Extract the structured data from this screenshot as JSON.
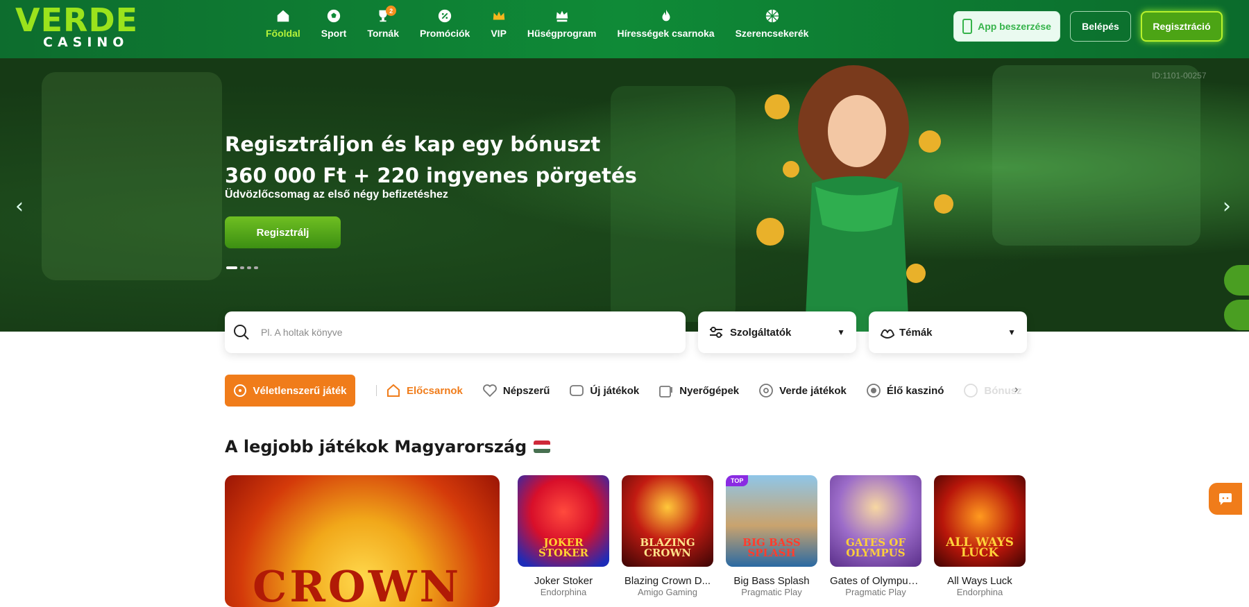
{
  "brand": {
    "logo_top": "VERDE",
    "logo_bottom": "CASINO"
  },
  "nav": {
    "items": [
      {
        "label": "Főoldal",
        "icon": "home-icon",
        "active": true
      },
      {
        "label": "Sport",
        "icon": "soccer-ball-icon"
      },
      {
        "label": "Tornák",
        "icon": "trophy-icon",
        "badge": "2"
      },
      {
        "label": "Promóciók",
        "icon": "gift-icon"
      },
      {
        "label": "VIP",
        "icon": "crown-icon"
      },
      {
        "label": "Hűségprogram",
        "icon": "loyalty-crown-icon"
      },
      {
        "label": "Híresség ek csarnoka",
        "icon": "flame-icon"
      },
      {
        "label": "Szerencsekerék",
        "icon": "wheel-icon"
      }
    ]
  },
  "header": {
    "app_btn": "App beszerzése",
    "login_btn": "Belépés",
    "register_btn": "Regisztráció"
  },
  "hero": {
    "title_line1": "Regisztráljon és kap egy bónuszt",
    "title_line2": "360 000 Ft + 220 ingyenes pörgetés",
    "subtitle": "Üdvözlőcsomag az első négy befizetéshez",
    "cta": "Regisztrálj",
    "code": "ID:1101-00257",
    "slides": 4,
    "active_slide": 1
  },
  "search": {
    "placeholder": "Pl. A holtak könyve"
  },
  "filters": {
    "providers": "Szolgáltatók",
    "themes": "Témák"
  },
  "categories": {
    "random_btn": "Véletlenszerű játék",
    "items": [
      {
        "label": "Előcsarnok",
        "icon": "lobby-icon",
        "active": true
      },
      {
        "label": "Népszerű",
        "icon": "heart-icon"
      },
      {
        "label": "Új játékok",
        "icon": "new-games-icon"
      },
      {
        "label": "Nyerőgépek",
        "icon": "slot-machine-icon"
      },
      {
        "label": "Verde játékok",
        "icon": "verde-icon"
      },
      {
        "label": "Élő kaszinó",
        "icon": "live-casino-icon"
      },
      {
        "label": "Bónusz",
        "icon": "bonus-icon"
      }
    ]
  },
  "section": {
    "title": "A legjobb játékok Magyarország",
    "featured_label": "CROWN",
    "games": [
      {
        "name": "Joker Stoker",
        "provider": "Endorphina",
        "art": "JOKER STOKER"
      },
      {
        "name": "Blazing Crown D...",
        "provider": "Amigo Gaming",
        "art": "BLAZING CROWN"
      },
      {
        "name": "Big Bass Splash",
        "provider": "Pragmatic Play",
        "art": "BIG BASS SPLASH",
        "tag": "TOP"
      },
      {
        "name": "Gates of Olympus...",
        "provider": "Pragmatic Play",
        "art": "GATES OF OLYMPUS"
      },
      {
        "name": "All Ways Luck",
        "provider": "Endorphina",
        "art": "ALL WAYS LUCK"
      }
    ]
  },
  "colors": {
    "accent_orange": "#f07c1a",
    "brand_green": "#0f8a37",
    "lime": "#9be31c"
  }
}
